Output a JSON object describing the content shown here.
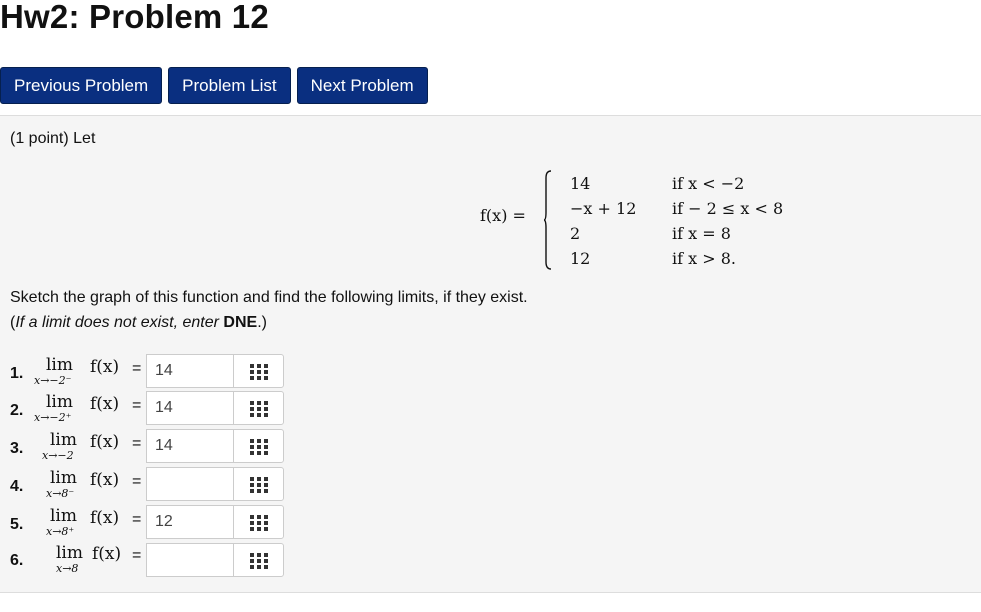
{
  "page": {
    "title": "Hw2: Problem 12"
  },
  "nav": {
    "previous": "Previous Problem",
    "list": "Problem List",
    "next": "Next Problem"
  },
  "problem": {
    "intro": "(1 point) Let",
    "function_lhs": "f(x) =",
    "pieces": [
      {
        "expr": "14",
        "cond": "if x < −2"
      },
      {
        "expr": "−x + 12",
        "cond": "if − 2 ≤ x < 8"
      },
      {
        "expr": "2",
        "cond": "if x = 8"
      },
      {
        "expr": "12",
        "cond": "if x > 8."
      }
    ],
    "sketch_text": "Sketch the graph of this function and find the following limits, if they exist.",
    "hint_prefix": "(",
    "hint_italic": "If a limit does not exist, enter ",
    "hint_bold": "DNE",
    "hint_suffix": ".)"
  },
  "limits": [
    {
      "num": "1.",
      "lim": "lim",
      "sub": "x→−2⁻",
      "f": "f(x)",
      "eq": "=",
      "value": "14"
    },
    {
      "num": "2.",
      "lim": "lim",
      "sub": "x→−2⁺",
      "f": "f(x)",
      "eq": "=",
      "value": "14"
    },
    {
      "num": "3.",
      "lim": "lim",
      "sub": "x→−2",
      "f": "f(x)",
      "eq": "=",
      "value": "14"
    },
    {
      "num": "4.",
      "lim": "lim",
      "sub": "x→8⁻",
      "f": "f(x)",
      "eq": "=",
      "value": ""
    },
    {
      "num": "5.",
      "lim": "lim",
      "sub": "x→8⁺",
      "f": "f(x)",
      "eq": "=",
      "value": "12"
    },
    {
      "num": "6.",
      "lim": "lim",
      "sub": "x→8",
      "f": "f(x)",
      "eq": "=",
      "value": ""
    }
  ],
  "icons": {
    "palette": "equation-palette-icon"
  },
  "colors": {
    "nav_button_bg": "#0a2f80",
    "panel_bg": "#f5f5f5"
  }
}
